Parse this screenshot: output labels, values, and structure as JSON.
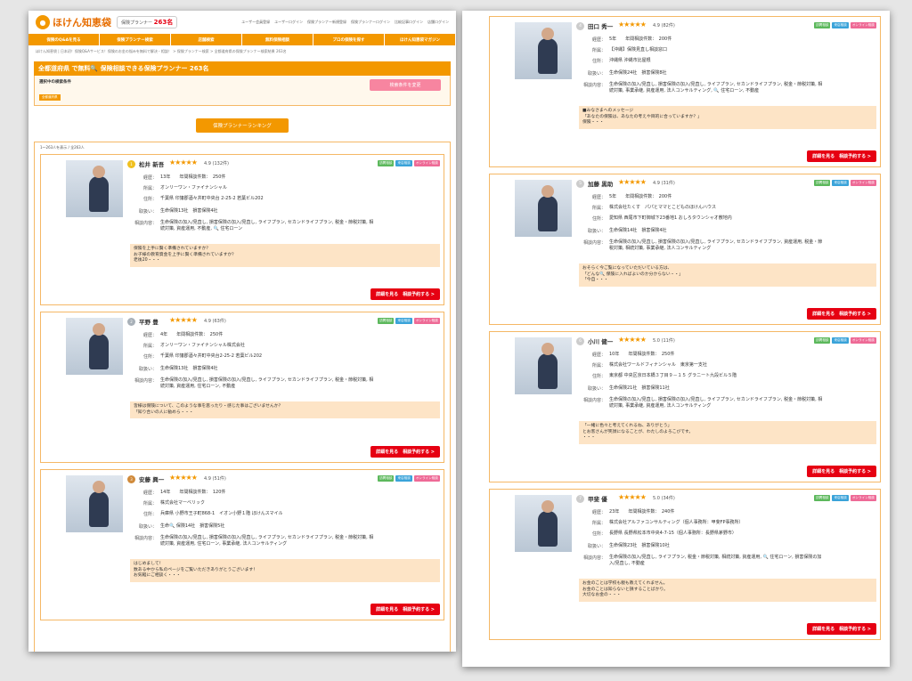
{
  "header": {
    "logo_text": "ほけん知恵袋",
    "count_label": "保険プランナー",
    "count_value": "263名",
    "links": [
      "ユーザー会員登録",
      "ユーザーログイン",
      "保険プランナー新規登録",
      "保険プランナーログイン",
      "比較記事ログイン",
      "店舗ログイン"
    ]
  },
  "nav": [
    "保険のQ&Aを見る",
    "保険プランナー検索",
    "店舗検索",
    "無料保険相談",
    "プロの保険を探す",
    "ほけん知恵袋マガジン"
  ],
  "breadcrumb": "ほけん知恵袋 | 日本初！保険Q&Aサービス！保険のお金の悩みを無料で解決・相談！ > 保険プランナー検索 > 全都道府県の保険プランナー検索結果 263名",
  "search": {
    "title": "全都道府県 で無料🔍 保険相談できる保険プランナー 263名",
    "cond_label": "選択中の検索条件",
    "cond_tag": "全都道府県",
    "change_button": "検索条件を変更",
    "ranking_button": "保険プランナーランキング",
    "result_count": "1〜263人を表示 / 全263人"
  },
  "labels": {
    "career": "経歴：",
    "office": "所属：",
    "address": "住所：",
    "handling": "取扱い：",
    "consult": "相談内容：",
    "detail_button": "詳細を見る　相談予約する >",
    "badge_visit": "訪問相談",
    "badge_store": "来店相談",
    "badge_online": "オンライン相談",
    "stars": "★★★★★"
  },
  "left_cards": [
    {
      "rank": "1",
      "name": "松井 新吾",
      "rating": "4.9 (132件)",
      "career": "13年　　年間相談件数：　250件",
      "office": "オンリーワン・ファイナンシャル",
      "address": "千葉県 印旛郡酒々井町中央台 2-25-2 若葉ビル202",
      "handling": "生命保険13社　損害保険4社",
      "consult": "生命保険の加入/見直し, 損害保険の加入/見直し, ライフプラン, セカンドライフプラン, 税金・節税対策, 相続対策, 資産運用, 不動産, 🔍 住宅ローン",
      "msg1": "保険を上手に賢く準備されていますか？",
      "msg2": "お子様の教育資金を上手に賢く準備されていますか？",
      "msg3": "老後20・・・"
    },
    {
      "rank": "2",
      "name": "平野 豊",
      "rating": "4.9 (63件)",
      "career": "4年　　年間相談件数：　250件",
      "office": "オンリーワン・ファイナンシャル株式会社",
      "address": "千葉県 印旛郡酒々井町中央台2-25-2 若葉ビル202",
      "handling": "生命保険13社　損害保険4社",
      "consult": "生命保険の加入/見直し, 損害保険の加入/見直し, ライフプラン, セカンドライフプラン, 税金・節税対策, 相続対策, 資産運用, 住宅ローン, 不動産",
      "msg1": "皆様は保険について、このような事を思ったり・感じた事はございませんか？",
      "msg2": "「知り合いの人に勧めら・・・",
      "msg3": ""
    },
    {
      "rank": "3",
      "name": "安藤 興一",
      "rating": "4.9 (51件)",
      "career": "14年　　年間相談件数：　120件",
      "office": "株式会社マーベリック",
      "address": "兵庫県 小野市王子町868-1　イオン小野１階 ほけんスマイル",
      "handling": "生命🔍 保険14社　損害保険5社",
      "consult": "生命保険の加入/見直し, 損害保険の加入/見直し, ライフプラン, セカンドライフプラン, 税金・節税対策, 相続対策, 資産運用, 住宅ローン, 事業承継, 法人コンサルティング",
      "msg1": "はじめまして！",
      "msg2": "数ある中から私のページをご覧いただきありがとうございます！",
      "msg3": "お気軽にご相談く・・・"
    }
  ],
  "right_cards": [
    {
      "rank": "4",
      "name": "田口 秀一",
      "rating": "4.9 (82件)",
      "career": "5年　　年間相談件数：　200件",
      "office": "【沖縄】保険見直し相談窓口",
      "address": "沖縄県 沖縄市比屋根",
      "handling": "生命保険24社　損害保険8社",
      "consult": "生命保険の加入/見直し, 損害保険の加入/見直し, ライフプラン, セカンドライフプラン, 税金・節税対策, 相続対策, 事業承継, 資産運用, 法人コンサルティング, 🔍 住宅ローン, 不動産",
      "msg1": "■みなさまへのメッセージ",
      "msg2": "「あなたの保険は、あなたの考えや目的に合っていますか？」",
      "msg3": "保険・・・"
    },
    {
      "rank": "5",
      "name": "加藤 黒助",
      "rating": "4.9 (31件)",
      "career": "5年　　年間相談件数：　200件",
      "office": "株式会社たくす　パパとママとこどものほけんハウス",
      "address": "愛知県 西尾市下町御城下23番地1 おしろタウンシャオ敷地内",
      "handling": "生命保険14社　損害保険4社",
      "consult": "生命保険の加入/見直し, 損害保険の加入/見直し, ライフプラン, セカンドライフプラン, 資産運用, 税金・節税対策, 相続対策, 事業承継, 法人コンサルティング",
      "msg1": "おそらく今ご覧になっていただいている方は、",
      "msg2": "「どんな🔍 保険に入ればよいのか分からない・・」",
      "msg3": "「今自・・・"
    },
    {
      "rank": "6",
      "name": "小川 健一",
      "rating": "5.0 (11件)",
      "career": "10年　　年間相談件数：　250件",
      "office": "株式会社ワールドフィナンシャル　東京第一支社",
      "address": "東京都 中央区京日本橋３丁目９－１５ グラニート九段ビル５階",
      "handling": "生命保険21社　損害保険11社",
      "consult": "生命保険の加入/見直し, 損害保険の加入/見直し, ライフプラン, セカンドライフプラン, 税金・節税対策, 相続対策, 事業承継, 資産運用, 法人コンサルティング",
      "msg1": "「一緒に色々と考えてくれるね、ありがとう」",
      "msg2": "とお客さんが笑顔になることが、わたしのよろこびです。",
      "msg3": "・・・"
    },
    {
      "rank": "7",
      "name": "甲斐 優",
      "rating": "5.0 (34件)",
      "career": "23年　　年間相談件数：　240件",
      "office": "株式会社アルファコンサルティング（個人事務所：甲斐FP事務所）",
      "address": "長野県 長野県松本市中央4-7-15（個人事務所：長野県茅野市）",
      "handling": "生命保険23社　損害保険10社",
      "consult": "生命保険の加入/見直し, ライフプラン, 税金・節税対策, 相続対策, 資産運用, 🔍 住宅ローン, 損害保険の加入/見直し, 不動産",
      "msg1": "お金のことは学校も親も教えてくれません。",
      "msg2": "お金のことは知らないと損することばかり。",
      "msg3": "大切なお金の・・・"
    }
  ]
}
